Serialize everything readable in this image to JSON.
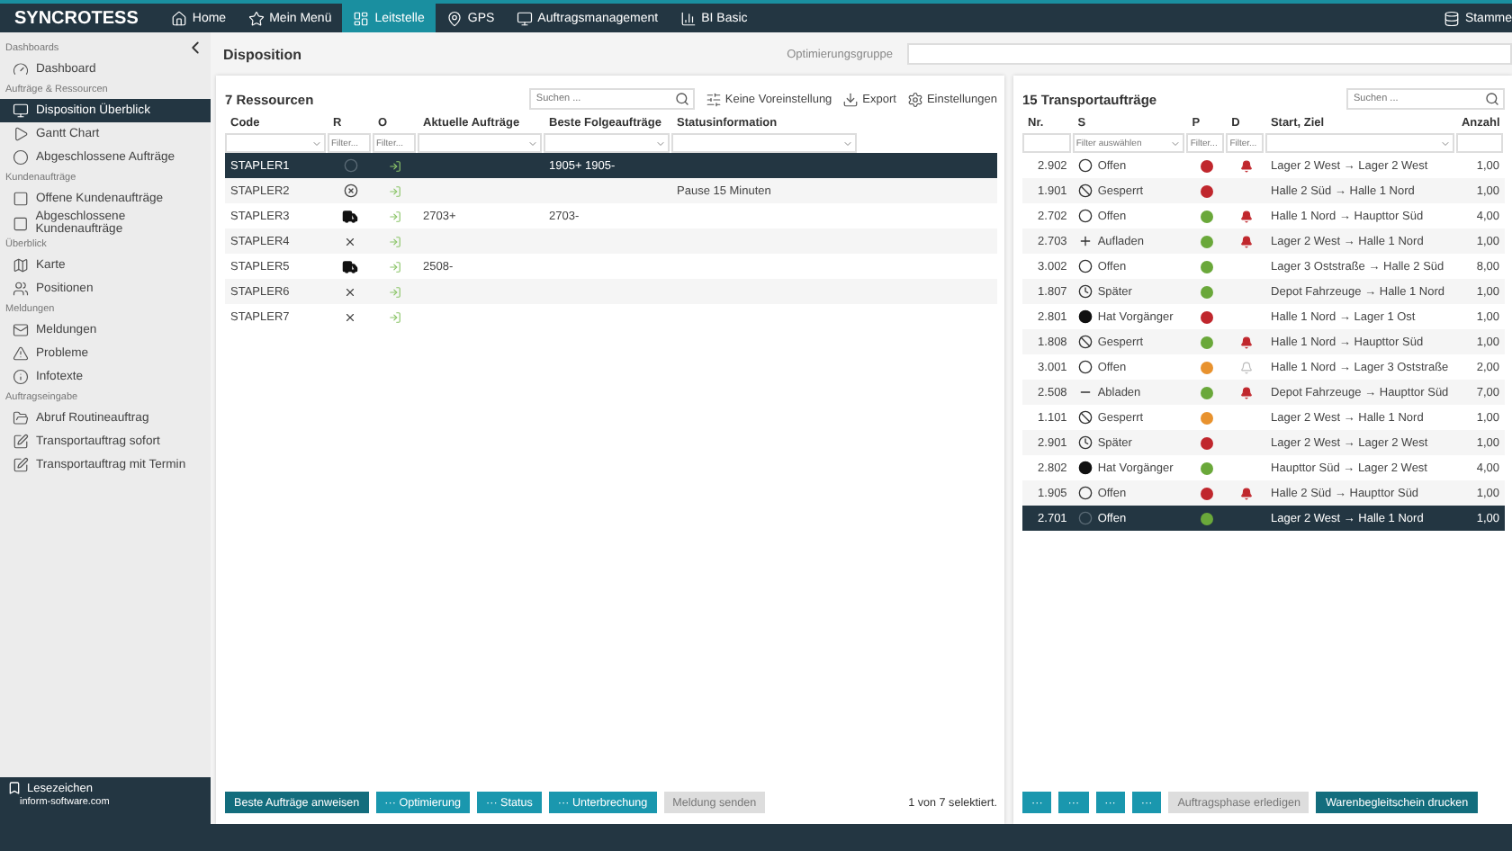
{
  "nav": {
    "brand": "SYNCROTESS",
    "items": [
      {
        "label": "Home",
        "selected": false
      },
      {
        "label": "Mein Menü",
        "selected": false
      },
      {
        "label": "Leitstelle",
        "selected": true
      },
      {
        "label": "GPS",
        "selected": false
      },
      {
        "label": "Auftragsmanagement",
        "selected": false
      },
      {
        "label": "BI Basic",
        "selected": false
      }
    ],
    "right": {
      "label": "Stamme"
    }
  },
  "sidebar": {
    "groups": [
      {
        "title": "Dashboards",
        "items": [
          {
            "label": "Dashboard",
            "selected": false
          }
        ]
      },
      {
        "title": "Aufträge & Ressourcen",
        "items": [
          {
            "label": "Disposition Überblick",
            "selected": true
          },
          {
            "label": "Gantt Chart",
            "selected": false
          },
          {
            "label": "Abgeschlossene Aufträge",
            "selected": false
          }
        ]
      },
      {
        "title": "Kundenaufträge",
        "items": [
          {
            "label": "Offene Kundenaufträge",
            "selected": false
          },
          {
            "label": "Abgeschlossene Kundenaufträge",
            "selected": false
          }
        ]
      },
      {
        "title": "Überblick",
        "items": [
          {
            "label": "Karte",
            "selected": false
          },
          {
            "label": "Positionen",
            "selected": false
          }
        ]
      },
      {
        "title": "Meldungen",
        "items": [
          {
            "label": "Meldungen",
            "selected": false
          },
          {
            "label": "Probleme",
            "selected": false
          },
          {
            "label": "Infotexte",
            "selected": false
          }
        ]
      },
      {
        "title": "Auftragseingabe",
        "items": [
          {
            "label": "Abruf Routineauftrag",
            "selected": false
          },
          {
            "label": "Transportauftrag sofort",
            "selected": false
          },
          {
            "label": "Transportauftrag mit Termin",
            "selected": false
          }
        ]
      }
    ],
    "bookmark": "Lesezeichen",
    "site": "inform-software.com"
  },
  "page": {
    "title": "Disposition",
    "group_label": "Optimierungsgruppe"
  },
  "resources": {
    "title": "7 Ressourcen",
    "search_placeholder": "Suchen ...",
    "tools": [
      {
        "label": "Keine Voreinstellung"
      },
      {
        "label": "Export"
      },
      {
        "label": "Einstellungen"
      }
    ],
    "columns": [
      {
        "label": "Code",
        "dropdown": true
      },
      {
        "label": "R",
        "filter": "Filter...",
        "dropdown": false
      },
      {
        "label": "O",
        "filter": "Filter...",
        "dropdown": false
      },
      {
        "label": "Aktuelle Aufträge",
        "dropdown": true
      },
      {
        "label": "Beste Folgeaufträge",
        "dropdown": true
      },
      {
        "label": "Statusinformation",
        "dropdown": true
      }
    ],
    "rows": [
      {
        "code": "STAPLER1",
        "kind": "idle",
        "next": "1905+ 1905-",
        "selected": true
      },
      {
        "code": "STAPLER2",
        "kind": "paused",
        "status": "Pause 15 Minuten",
        "selected": false
      },
      {
        "code": "STAPLER3",
        "kind": "truck",
        "current": "2703+",
        "next": "2703-",
        "selected": false
      },
      {
        "code": "STAPLER4",
        "kind": "none",
        "selected": false
      },
      {
        "code": "STAPLER5",
        "kind": "truck",
        "current": "2508-",
        "selected": false
      },
      {
        "code": "STAPLER6",
        "kind": "none",
        "selected": false
      },
      {
        "code": "STAPLER7",
        "kind": "none",
        "selected": false
      }
    ],
    "buttons": [
      {
        "label": "Beste Aufträge anweisen",
        "kind": "primary"
      },
      {
        "label": "··· Optimierung",
        "kind": "secondary"
      },
      {
        "label": "··· Status",
        "kind": "secondary"
      },
      {
        "label": "··· Unterbrechung",
        "kind": "secondary"
      },
      {
        "label": "Meldung senden",
        "kind": "disabled"
      }
    ],
    "selection": "1 von 7 selektiert."
  },
  "orders": {
    "title": "15 Transportaufträge",
    "search_placeholder": "Suchen ...",
    "columns": [
      {
        "label": "Nr.",
        "dropdown": false
      },
      {
        "label": "S",
        "filter": "Filter auswählen",
        "dropdown": true
      },
      {
        "label": "P",
        "filter": "Filter...",
        "dropdown": false
      },
      {
        "label": "D",
        "filter": "Filter...",
        "dropdown": false
      },
      {
        "label": "Start, Ziel",
        "dropdown": true
      },
      {
        "label": "Anzahl",
        "dropdown": false
      }
    ],
    "rows": [
      {
        "nr": "2.902",
        "kind": "offen",
        "status": "Offen",
        "color": "#c0272d",
        "bell": true,
        "alarm": true,
        "route": "Lager 2 West → Lager 2 West",
        "count": "1,00",
        "selected": false
      },
      {
        "nr": "1.901",
        "kind": "gesperrt",
        "status": "Gesperrt",
        "color": "#c0272d",
        "bell": false,
        "route": "Halle 2 Süd → Halle 1 Nord",
        "count": "1,00",
        "selected": false
      },
      {
        "nr": "2.702",
        "kind": "offen",
        "status": "Offen",
        "color": "#6aa83a",
        "bell": true,
        "alarm": true,
        "route": "Halle 1 Nord → Haupttor Süd",
        "count": "4,00",
        "selected": false
      },
      {
        "nr": "2.703",
        "kind": "aufladen",
        "status": "Aufladen",
        "color": "#6aa83a",
        "bell": true,
        "alarm": true,
        "route": "Lager 2 West → Halle 1 Nord",
        "count": "1,00",
        "selected": false
      },
      {
        "nr": "3.002",
        "kind": "offen",
        "status": "Offen",
        "color": "#6aa83a",
        "bell": false,
        "route": "Lager 3 Oststraße → Halle 2 Süd",
        "count": "8,00",
        "selected": false
      },
      {
        "nr": "1.807",
        "kind": "spaeter",
        "status": "Später",
        "color": "#6aa83a",
        "bell": false,
        "route": "Depot Fahrzeuge → Halle 1 Nord",
        "count": "1,00",
        "selected": false
      },
      {
        "nr": "2.801",
        "kind": "vorgaenger",
        "status": "Hat Vorgänger",
        "color": "#c0272d",
        "bell": false,
        "route": "Halle 1 Nord → Lager 1 Ost",
        "count": "1,00",
        "selected": false
      },
      {
        "nr": "1.808",
        "kind": "gesperrt",
        "status": "Gesperrt",
        "color": "#6aa83a",
        "bell": true,
        "alarm": true,
        "route": "Halle 1 Nord → Haupttor Süd",
        "count": "1,00",
        "selected": false
      },
      {
        "nr": "3.001",
        "kind": "offen",
        "status": "Offen",
        "color": "#e8922e",
        "bell": true,
        "alarm": false,
        "route": "Halle 1 Nord → Lager 3 Oststraße",
        "count": "2,00",
        "selected": false
      },
      {
        "nr": "2.508",
        "kind": "abladen",
        "status": "Abladen",
        "color": "#6aa83a",
        "bell": true,
        "alarm": true,
        "route": "Depot Fahrzeuge → Haupttor Süd",
        "count": "7,00",
        "selected": false
      },
      {
        "nr": "1.101",
        "kind": "gesperrt",
        "status": "Gesperrt",
        "color": "#e8922e",
        "bell": false,
        "route": "Lager 2 West → Halle 1 Nord",
        "count": "1,00",
        "selected": false
      },
      {
        "nr": "2.901",
        "kind": "spaeter",
        "status": "Später",
        "color": "#c0272d",
        "bell": false,
        "route": "Lager 2 West → Lager 2 West",
        "count": "1,00",
        "selected": false
      },
      {
        "nr": "2.802",
        "kind": "vorgaenger",
        "status": "Hat Vorgänger",
        "color": "#6aa83a",
        "bell": false,
        "route": "Haupttor Süd → Lager 2 West",
        "count": "4,00",
        "selected": false
      },
      {
        "nr": "1.905",
        "kind": "offen",
        "status": "Offen",
        "color": "#c0272d",
        "bell": true,
        "alarm": true,
        "route": "Halle 2 Süd → Haupttor Süd",
        "count": "1,00",
        "selected": false
      },
      {
        "nr": "2.701",
        "kind": "offen",
        "status": "Offen",
        "color": "#6aa83a",
        "bell": false,
        "route": "Lager 2 West → Halle 1 Nord",
        "count": "1,00",
        "selected": true
      }
    ],
    "buttons": [
      {
        "label": "···",
        "kind": "secondary"
      },
      {
        "label": "···",
        "kind": "secondary"
      },
      {
        "label": "···",
        "kind": "secondary"
      },
      {
        "label": "···",
        "kind": "secondary"
      },
      {
        "label": "Auftragsphase erledigen",
        "kind": "disabled"
      },
      {
        "label": "Warenbegleitschein drucken",
        "kind": "primary"
      }
    ]
  }
}
